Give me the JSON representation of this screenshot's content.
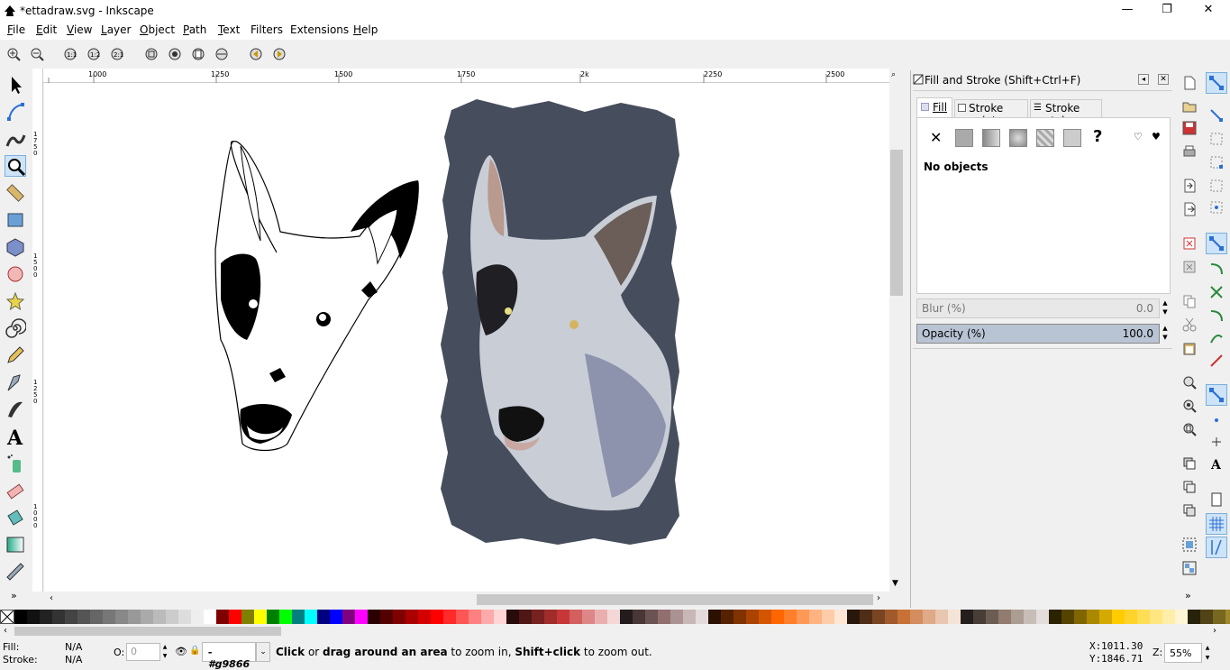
{
  "window": {
    "title": "*ettadraw.svg - Inkscape",
    "minimize": "—",
    "restore": "❐",
    "close": "✕"
  },
  "menu": [
    {
      "label": "File",
      "u": "F",
      "rest": "ile"
    },
    {
      "label": "Edit",
      "u": "E",
      "rest": "dit"
    },
    {
      "label": "View",
      "u": "V",
      "rest": "iew"
    },
    {
      "label": "Layer",
      "u": "L",
      "rest": "ayer"
    },
    {
      "label": "Object",
      "u": "O",
      "rest": "bject"
    },
    {
      "label": "Path",
      "u": "P",
      "rest": "ath"
    },
    {
      "label": "Text",
      "u": "T",
      "rest": "ext"
    },
    {
      "label": "Filters",
      "u": "",
      "rest": "Filters"
    },
    {
      "label": "Extensions",
      "u": "x",
      "rest": "Extensions"
    },
    {
      "label": "Help",
      "u": "H",
      "rest": "elp"
    }
  ],
  "ruler": {
    "top": [
      "1000",
      "1250",
      "1500",
      "1750",
      "2k",
      "2250",
      "2500"
    ],
    "left": [
      "1750",
      "1500",
      "1250",
      "1000"
    ]
  },
  "panel": {
    "title": "Fill and Stroke (Shift+Ctrl+F)",
    "tabs": [
      "Fill",
      "Stroke paint",
      "Stroke style"
    ],
    "message": "No objects",
    "blur_label": "Blur (%)",
    "blur_value": "0.0",
    "opacity_label": "Opacity (%)",
    "opacity_value": "100.0",
    "opacity_level": 1.0
  },
  "status": {
    "fill_label": "Fill:",
    "fill_value": "N/A",
    "stroke_label": "Stroke:",
    "stroke_value": "N/A",
    "o_label": "O:",
    "o_value": "0",
    "layer": "-#g9866",
    "msg_bold1": "Click",
    "msg1": " or ",
    "msg_bold2": "drag around an area",
    "msg2": " to zoom in, ",
    "msg_bold3": "Shift+click",
    "msg3": " to zoom out.",
    "x_label": "X:",
    "x_value": "1011.30",
    "y_label": "Y:",
    "y_value": "1846.71",
    "z_label": "Z:",
    "zoom": "55%"
  },
  "colors": {
    "accent": "#3c8ad6",
    "bg": "#f0f0f0"
  },
  "icons": {
    "tools": [
      "selector-icon",
      "node-icon",
      "tweak-icon",
      "zoom-icon",
      "measure-icon",
      "rect-icon",
      "3dbox-icon",
      "ellipse-icon",
      "star-icon",
      "spiral-icon",
      "pencil-icon",
      "pen-icon",
      "calligraphy-icon",
      "text-icon",
      "spray-icon",
      "eraser-icon",
      "bucket-icon",
      "gradient-icon",
      "dropper-icon"
    ]
  }
}
